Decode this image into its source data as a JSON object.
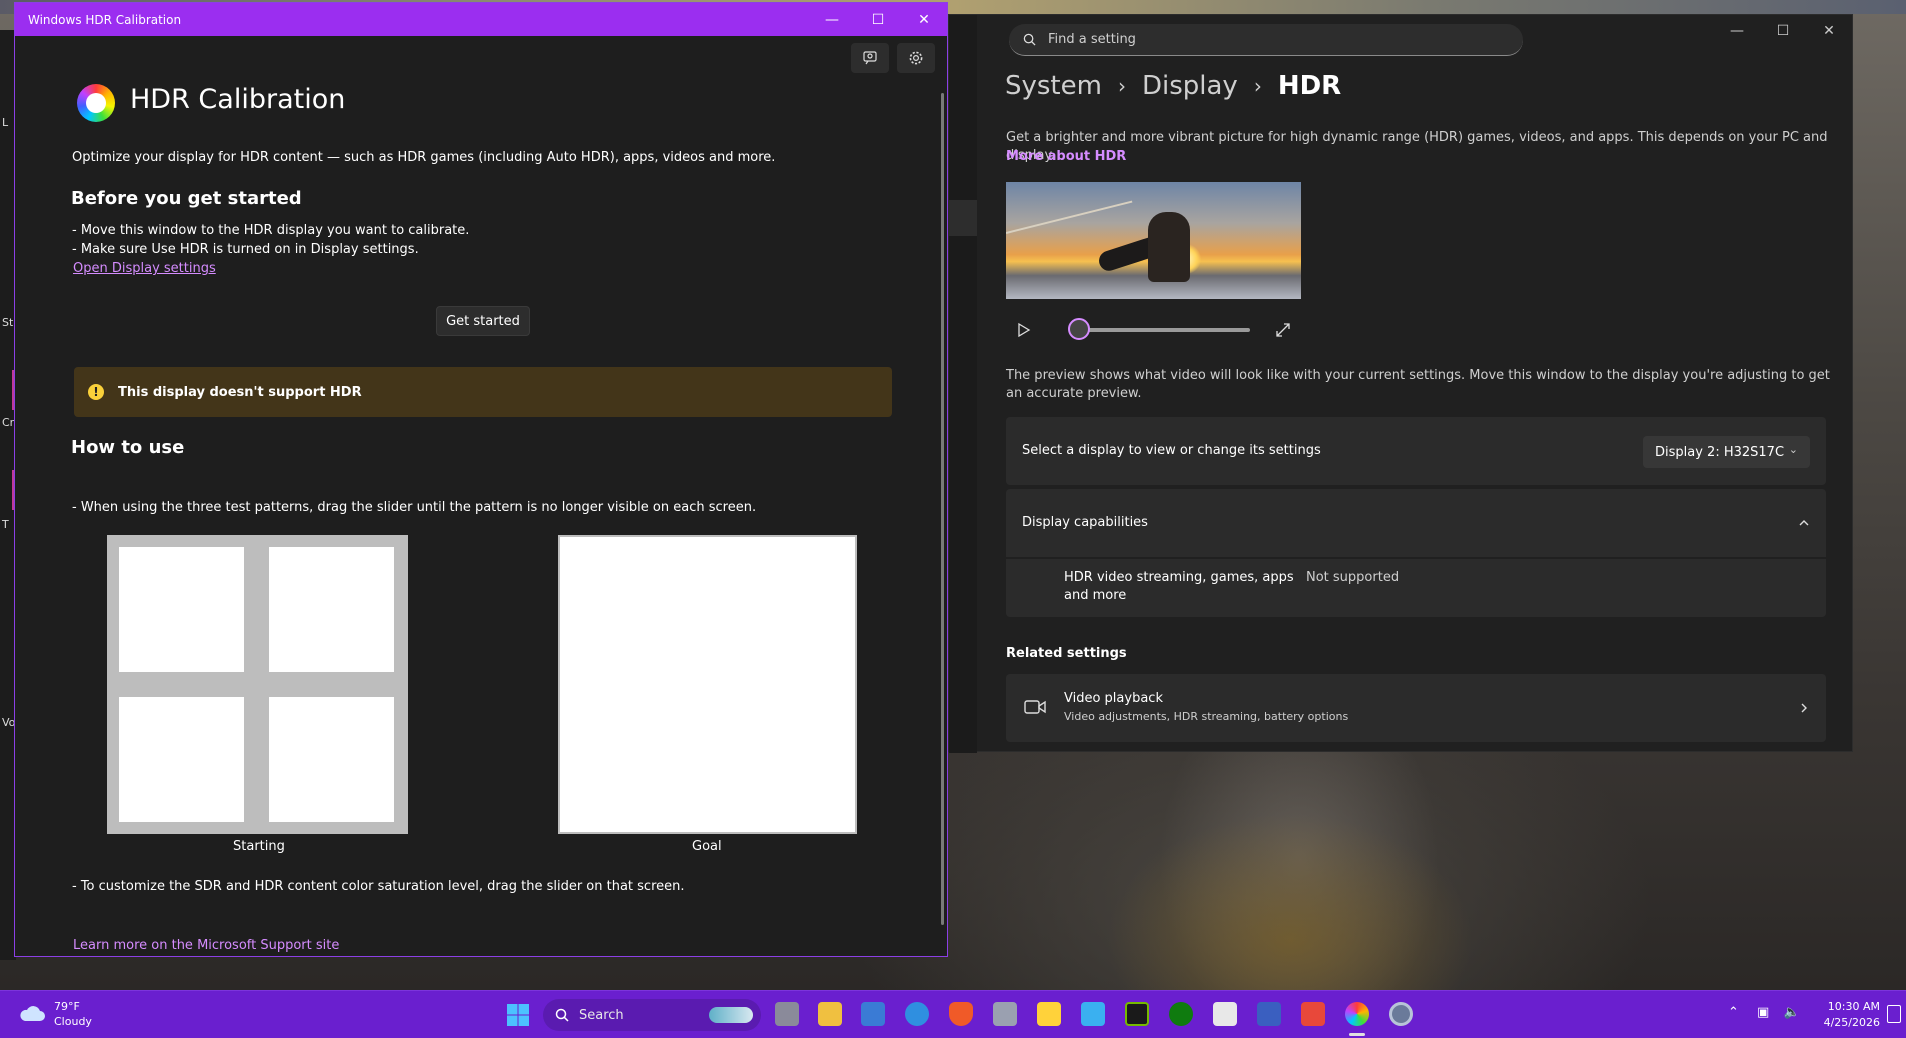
{
  "left_peek": [
    "L",
    "St",
    "Cr",
    "T",
    "Vo"
  ],
  "calibration": {
    "window_title": "Windows HDR Calibration",
    "app_title": "HDR Calibration",
    "intro": "Optimize your display for HDR content — such as HDR games (including Auto HDR), apps, videos and more.",
    "before_heading": "Before you get started",
    "steps": [
      "- Move this window to the HDR display you want to calibrate.",
      "- Make sure Use HDR is turned on in Display settings."
    ],
    "open_display_settings": "Open Display settings",
    "get_started": "Get started",
    "warning": "This display doesn't support HDR",
    "how_to_heading": "How to use",
    "how_to_text": "- When using the three test patterns, drag the slider until the pattern is no longer visible on each screen.",
    "pattern_start_label": "Starting",
    "pattern_goal_label": "Goal",
    "saturation_text": "- To customize the SDR and HDR content color saturation level, drag the slider on that screen.",
    "learn_more": "Learn more on the Microsoft Support site"
  },
  "settings": {
    "search_placeholder": "Find a setting",
    "breadcrumb": [
      "System",
      "Display",
      "HDR"
    ],
    "description": "Get a brighter and more vibrant picture for high dynamic range (HDR) games, videos, and apps. This depends on your PC and display.",
    "more_about": "More about HDR",
    "preview_note": "The preview shows what video will look like with your current settings. Move this window to the display you're adjusting to get an accurate preview.",
    "video_progress": 0,
    "select_display_label": "Select a display to view or change its settings",
    "display_dropdown": "Display 2: H32S17C",
    "capabilities_label": "Display capabilities",
    "capability_name": "HDR video streaming, games, apps and more",
    "capability_value": "Not supported",
    "related_heading": "Related settings",
    "video_playback_title": "Video playback",
    "video_playback_sub": "Video adjustments, HDR streaming, battery options"
  },
  "taskbar": {
    "temperature": "79°F",
    "condition": "Cloudy",
    "search_label": "Search",
    "time": "10:30 AM",
    "date": "4/25/2026"
  },
  "colors": {
    "accent_purple": "#9b2ef0",
    "taskbar": "#6a1fcf",
    "link": "#d58cff",
    "warning_bg": "#433519"
  }
}
